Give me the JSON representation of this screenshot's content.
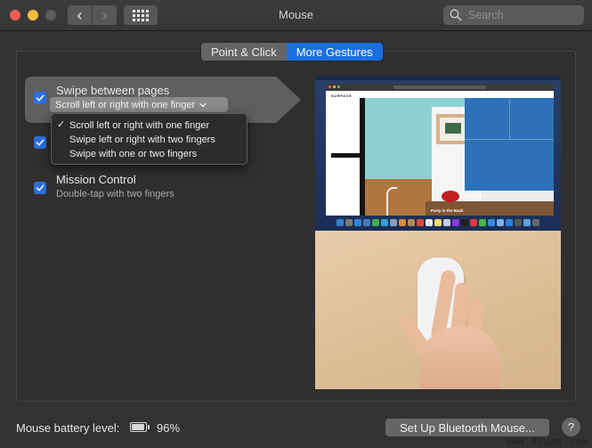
{
  "window": {
    "title": "Mouse",
    "search_placeholder": "Search",
    "back_glyph": "‹",
    "forward_glyph": "›",
    "icons": {
      "close": "close-light",
      "minimize": "minimize-light",
      "zoom": "zoom-light",
      "back": "chevron-left-icon",
      "forward": "chevron-right-icon",
      "show_all": "grid-icon",
      "search": "magnifier-icon"
    }
  },
  "tabs": [
    {
      "label": "Point & Click",
      "selected": false
    },
    {
      "label": "More Gestures",
      "selected": true
    }
  ],
  "gestures": [
    {
      "title": "Swipe between pages",
      "checked": true,
      "highlighted": true,
      "popup_value": "Scroll left or right with one finger",
      "popup_chevron": "⌄"
    },
    {
      "title": "",
      "checked": true,
      "hidden_by_menu": true
    },
    {
      "title": "Mission Control",
      "subtitle": "Double-tap with two fingers",
      "checked": true
    }
  ],
  "popup_menu": {
    "check_glyph": "✓",
    "options": [
      {
        "label": "Scroll left or right with one finger",
        "selected": true
      },
      {
        "label": "Swipe left or right with two fingers",
        "selected": false
      },
      {
        "label": "Swipe with one or two fingers",
        "selected": false
      }
    ]
  },
  "preview": {
    "description": "Gesture demo video: hand using Magic Mouse below a Mac desktop screenshot",
    "site_brand": "SURFACE",
    "caption": "Party in the Back"
  },
  "footer": {
    "battery_label": "Mouse battery level:",
    "battery_percent": "96%",
    "battery_level": 0.96,
    "setup_button": "Set Up Bluetooth Mouse...",
    "help_glyph": "?"
  },
  "watermark": "www.deuaq.com",
  "colors": {
    "accent": "#1a6fe0",
    "checkbox": "#2a6fe0",
    "close": "#ec5f57",
    "minimize": "#f4bd3f",
    "zoom_disabled": "#5d5d5d",
    "background": "#323232"
  }
}
